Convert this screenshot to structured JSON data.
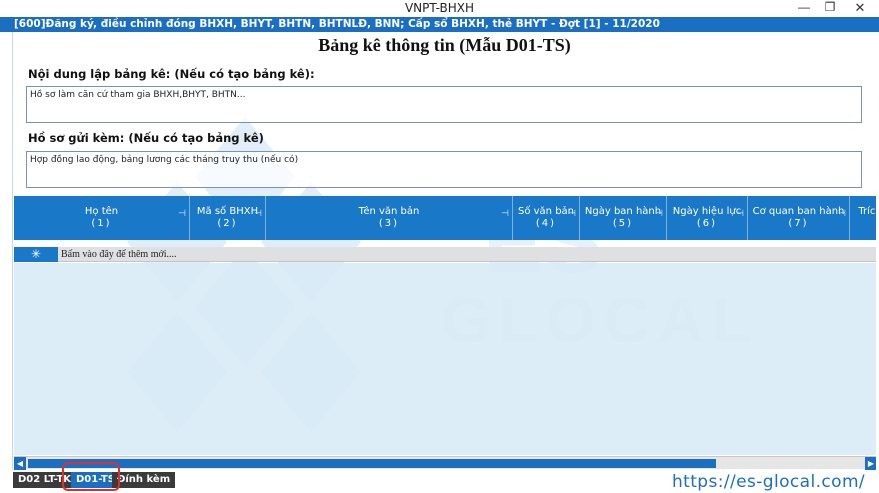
{
  "window": {
    "title": "VNPT-BHXH",
    "minimize_glyph": "—",
    "maximize_glyph": "❐",
    "close_glyph": "✕"
  },
  "form": {
    "header": "[600]Đăng ký, điều chỉnh đóng BHXH, BHYT, BHTN, BHTNLĐ, BNN; Cấp sổ BHXH, thẻ BHYT - Đợt [1] - 11/2020",
    "page_title": "Bảng kê thông tin (Mẫu D01-TS)",
    "content_label": "Nội dung lập bảng kê: (Nếu có tạo bảng kê):",
    "content_value": "Hồ sơ làm căn cứ tham gia BHXH,BHYT, BHTN...",
    "attached_label": "Hồ sơ gửi kèm: (Nếu có tạo bảng kê)",
    "attached_value": "Hợp đồng lao động, bảng lương các tháng truy thu (nếu có)"
  },
  "grid": {
    "columns": [
      {
        "title": "Họ tên",
        "num": "(1)"
      },
      {
        "title": "Mã số BHXH",
        "num": "(2)"
      },
      {
        "title": "Tên văn bản",
        "num": "(3)"
      },
      {
        "title": "Số văn bản",
        "num": "(4)"
      },
      {
        "title": "Ngày ban hành",
        "num": "(5)"
      },
      {
        "title": "Ngày hiệu lực",
        "num": "(6)"
      },
      {
        "title": "Cơ quan ban hành",
        "num": "(7)"
      },
      {
        "title": "Trích",
        "num": ""
      }
    ],
    "pin_glyph": "⊣",
    "new_row_marker": "✳",
    "new_row_hint": "Bấm vào đây để thêm mới...."
  },
  "scroll": {
    "left_arrow": "◀",
    "right_arrow": "▶"
  },
  "tabs": [
    {
      "label": "D02 LT-TK1"
    },
    {
      "label": "D01-TS"
    },
    {
      "label": "Đính kèm"
    }
  ],
  "watermark": {
    "brand_top": "ES",
    "brand_bottom": "GLOCAL"
  },
  "site_url": "https://es-glocal.com/",
  "colors": {
    "accent": "#1a78c9",
    "highlight": "#d7322e",
    "grid_body": "#d6eaf6"
  }
}
